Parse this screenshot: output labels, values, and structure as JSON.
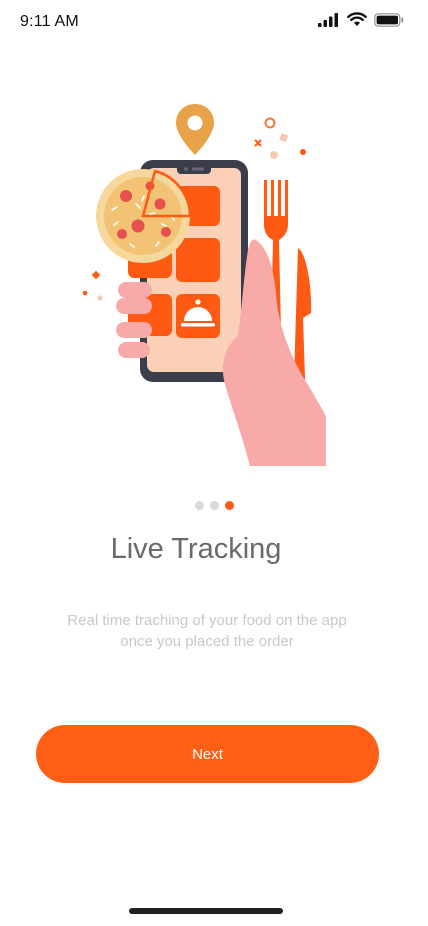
{
  "status_bar": {
    "time": "9:11 AM",
    "icons": [
      "signal-icon",
      "wifi-icon",
      "battery-icon"
    ]
  },
  "onboarding": {
    "illustration": "phone-tracking-illustration",
    "pager": {
      "total": 3,
      "active_index": 2
    },
    "title": "Live Tracking",
    "description_lines": [
      "Real time traching of your food on the app",
      "once you placed the order"
    ],
    "next_label": "Next"
  },
  "colors": {
    "accent": "#ff5f14",
    "title": "#6a6a6a",
    "description": "#c9c9c9",
    "dot_inactive": "#d9d9d9"
  }
}
